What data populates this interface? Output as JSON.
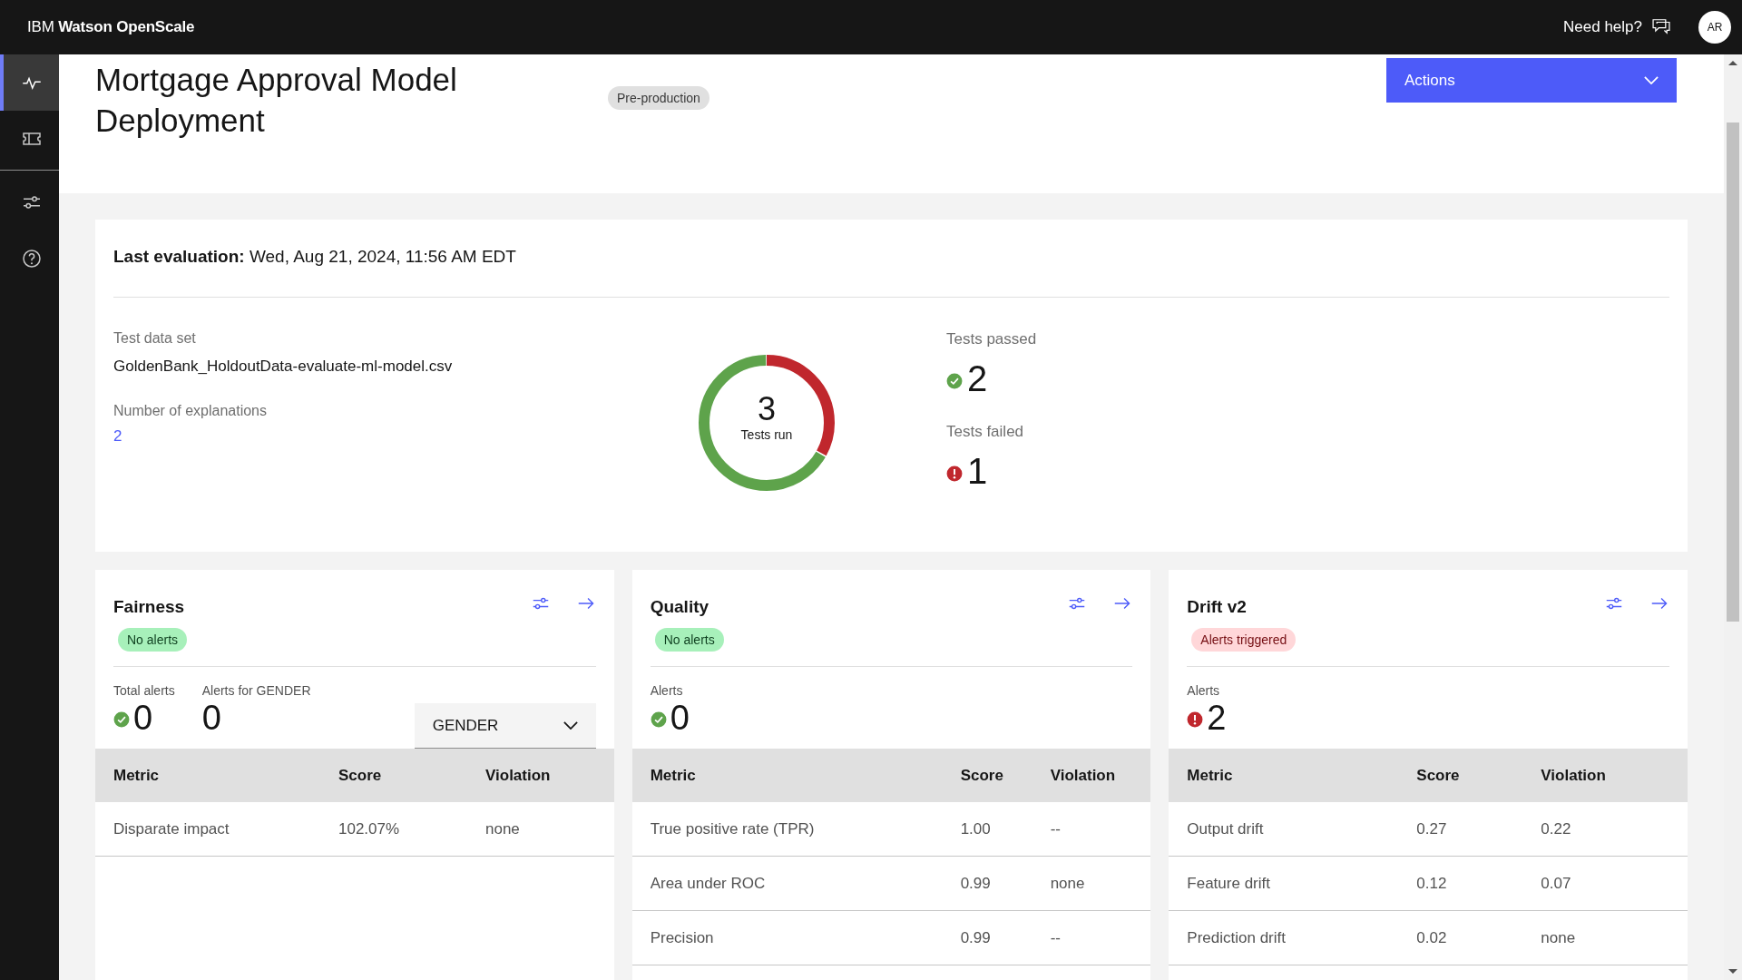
{
  "app": {
    "title_light": "IBM",
    "title_bold": "Watson OpenScale",
    "help": "Need help?",
    "avatar": "AR"
  },
  "sidebar": {
    "items": [
      {
        "kind": "pulse",
        "selected": true
      },
      {
        "kind": "ticket",
        "selected": false
      },
      {
        "kind": "sliders",
        "selected": false
      },
      {
        "kind": "help",
        "selected": false
      }
    ]
  },
  "header": {
    "title": "Mortgage Approval Model Deployment",
    "tag": "Pre-production",
    "actions": "Actions"
  },
  "summary": {
    "last_evaluation": "**Last evaluation:** Wed, Aug 21, 2024, 11:56 AM EDT",
    "fields": [
      {
        "label": "Test data set",
        "value": "GoldenBank_HoldoutData-evaluate-ml-model.csv",
        "kind": "text"
      },
      {
        "label": "Number of explanations",
        "value": "2",
        "kind": "link"
      }
    ],
    "center_value": "3",
    "center_label": "Tests run",
    "stats": [
      {
        "label": "Tests passed",
        "value": "2",
        "kind": "ok"
      },
      {
        "label": "Tests failed",
        "value": "1",
        "kind": "alert"
      }
    ]
  },
  "cards": [
    {
      "title": "Fairness",
      "tag": {
        "text": "No alerts",
        "alert": false
      },
      "metrics": [
        {
          "label": "Total alerts",
          "value": "0",
          "kind": "ok"
        },
        {
          "label": "Alerts for GENDER",
          "value": "0",
          "kind": "plain"
        }
      ],
      "dropdown": "GENDER",
      "table": {
        "columns": [
          "Metric",
          "Score",
          "Violation"
        ],
        "rows": [
          [
            "Disparate impact",
            "102.07%",
            "none"
          ]
        ]
      }
    },
    {
      "title": "Quality",
      "tag": {
        "text": "No alerts",
        "alert": false
      },
      "metrics": [
        {
          "label": "Alerts",
          "value": "0",
          "kind": "ok"
        }
      ],
      "table": {
        "columns": [
          "Metric",
          "Score",
          "Violation"
        ],
        "rows": [
          [
            "True positive rate (TPR)",
            "1.00",
            "--"
          ],
          [
            "Area under ROC",
            "0.99",
            "none"
          ],
          [
            "Precision",
            "0.99",
            "--"
          ]
        ]
      }
    },
    {
      "title": "Drift v2",
      "tag": {
        "text": "Alerts triggered",
        "alert": true
      },
      "metrics": [
        {
          "label": "Alerts",
          "value": "2",
          "kind": "alert"
        }
      ],
      "table": {
        "columns": [
          "Metric",
          "Score",
          "Violation"
        ],
        "rows": [
          [
            "Output drift",
            "0.27",
            "0.22"
          ],
          [
            "Feature drift",
            "0.12",
            "0.07"
          ],
          [
            "Prediction drift",
            "0.02",
            "none"
          ]
        ]
      }
    }
  ]
}
